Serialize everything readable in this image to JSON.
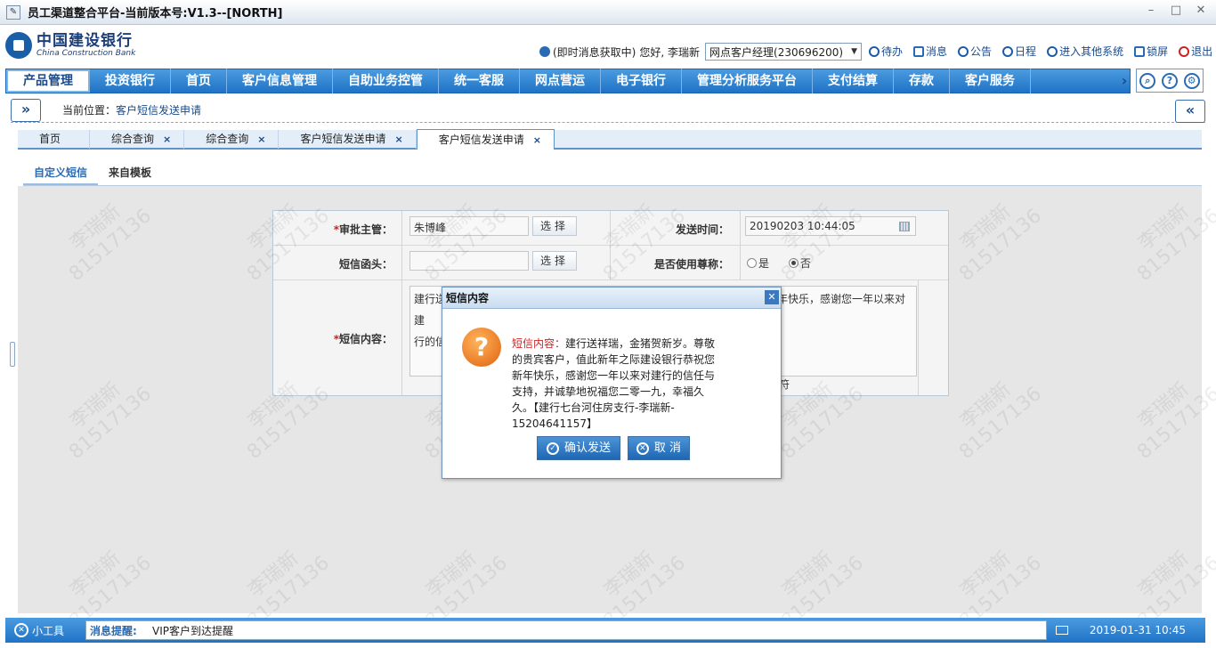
{
  "window": {
    "title": "员工渠道整合平台-当前版本号:V1.3--[NORTH]",
    "controls": [
      "–",
      "□",
      "✕"
    ]
  },
  "brand": {
    "cn": "中国建设银行",
    "en": "China Construction Bank"
  },
  "user": {
    "notice": "(即时消息获取中)",
    "greeting": "您好, 李瑞新",
    "role": "网点客户经理(230696200)"
  },
  "toplinks": [
    {
      "label": "待办",
      "icon": "todo-icon"
    },
    {
      "label": "消息",
      "icon": "message-icon"
    },
    {
      "label": "公告",
      "icon": "announcement-icon"
    },
    {
      "label": "日程",
      "icon": "schedule-icon"
    },
    {
      "label": "进入其他系统",
      "icon": "other-systems-icon"
    },
    {
      "label": "锁屏",
      "icon": "lock-icon"
    },
    {
      "label": "退出",
      "icon": "logout-icon"
    }
  ],
  "nav": {
    "items": [
      "产品管理",
      "投资银行",
      "首页",
      "客户信息管理",
      "自助业务控管",
      "统一客服",
      "网点营运",
      "电子银行",
      "管理分析服务平台",
      "支付结算",
      "存款",
      "客户服务"
    ],
    "active": 0,
    "next": "›"
  },
  "navtools": {
    "search": "⌕",
    "help": "?",
    "settings": "⚙"
  },
  "breadcrumb": {
    "expand": "»",
    "collapse": "«",
    "label": "当前位置：",
    "current": "客户短信发送申请"
  },
  "tabs": [
    {
      "label": "首页",
      "closable": false
    },
    {
      "label": "综合查询",
      "closable": true
    },
    {
      "label": "综合查询",
      "closable": true
    },
    {
      "label": "客户短信发送申请",
      "closable": true
    },
    {
      "label": "客户短信发送申请",
      "closable": true,
      "active": true
    }
  ],
  "tab_close": "×",
  "subtabs": [
    "自定义短信",
    "来自模板"
  ],
  "form": {
    "approver_label": "审批主管：",
    "approver_value": "朱博峰",
    "select_btn": "选择",
    "send_time_label": "发送时间：",
    "send_time_value": "20190203 10:44:05",
    "header_label": "短信函头：",
    "header_value": "",
    "use_title_label": "是否使用尊称：",
    "opt_yes": "是",
    "opt_no": "否",
    "content_label": "短信内容：",
    "required_mark": "*",
    "content_line1_left": "建行送",
    "content_line2_left": "行的信",
    "content_line1_right": "年快乐，感谢您一年以来对建",
    "content_tail": "符"
  },
  "dialog": {
    "title": "短信内容",
    "close": "✕",
    "icon": "?",
    "label": "短信内容：",
    "lines": [
      "建行送祥瑞，金猪贺新岁。尊敬",
      "的贵宾客户，值此新年之际建设银行恭祝您",
      "新年快乐，感谢您一年以来对建行的信任与",
      "支持，并诚挚地祝福您二零一九，幸福久",
      "久。【建行七台河住房支行-李瑞新-",
      "15204641157】"
    ],
    "confirm": "确认发送",
    "cancel": "取 消"
  },
  "watermark": {
    "name": "李瑞新",
    "id": "81517136"
  },
  "statusbar": {
    "tools": "小工具",
    "msg_label": "消息提醒:",
    "msg": "VIP客户到达提醒",
    "time": "2019-01-31 10:45"
  }
}
